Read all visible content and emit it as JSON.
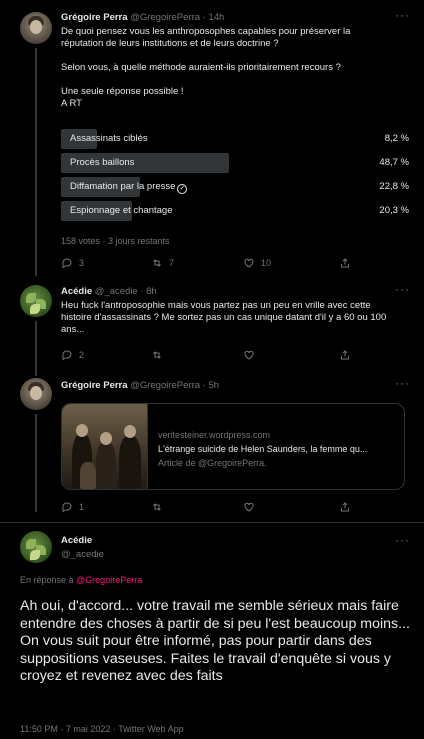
{
  "tweet1": {
    "name": "Grégoire Perra",
    "handle": "@GregoirePerra",
    "time": "14h",
    "text": "De quoi pensez vous les anthroposophes capables pour préserver la réputation de leurs institutions et de leurs doctrine ?\n\nSelon vous, à quelle méthode auraient-ils prioritairement recours ?\n\nUne seule réponse possible !\nA RT",
    "poll": [
      {
        "label": "Assassinats ciblés",
        "pct": "8,2 %",
        "value": 8.2
      },
      {
        "label": "Procès baillons",
        "pct": "48,7 %",
        "value": 48.7
      },
      {
        "label": "Diffamation par la presse",
        "pct": "22,8 %",
        "value": 22.8,
        "voted": true
      },
      {
        "label": "Espionnage et chantage",
        "pct": "20,3 %",
        "value": 20.3
      }
    ],
    "poll_meta": "158 votes · 3 jours restants",
    "replies": "3",
    "retweets": "7",
    "likes": "10"
  },
  "tweet2": {
    "name": "Acédie",
    "handle": "@_acedie",
    "time": "8h",
    "text": "Heu fuck l'antroposophie mais vous partez pas un peu en vrille avec cette histoire d'assassinats ? Me sortez pas un cas unique datant d'il y a 60 ou 100 ans...",
    "replies": "2"
  },
  "tweet3": {
    "name": "Grégoire Perra",
    "handle": "@GregoirePerra",
    "time": "5h",
    "card": {
      "domain": "veritesteiner.wordpress.com",
      "title": "L'étrange suicide de Helen Saunders, la femme qu...",
      "subtitle": "Article de @GregoirePerra."
    },
    "replies": "1"
  },
  "tweet4": {
    "name": "Acédie",
    "handle": "@_acedie",
    "reply_prefix": "En réponse à ",
    "reply_to": "@GregoirePerra",
    "text": "Ah oui, d'accord... votre travail me semble sérieux mais faire entendre des choses à partir de si peu l'est beaucoup moins... On vous suit pour être informé, pas pour partir dans des suppositions vaseuses. Faites le travail d'enquête si vous y croyez et revenez avec des faits",
    "meta": "11:50 PM · 7 mai 2022 · Twitter Web App"
  },
  "colors": {
    "accent": "#f91880",
    "bar": "#333639",
    "muted": "#71767b"
  },
  "icons": [
    "reply-icon",
    "retweet-icon",
    "like-icon",
    "share-icon",
    "more-icon",
    "check-circle-icon"
  ]
}
